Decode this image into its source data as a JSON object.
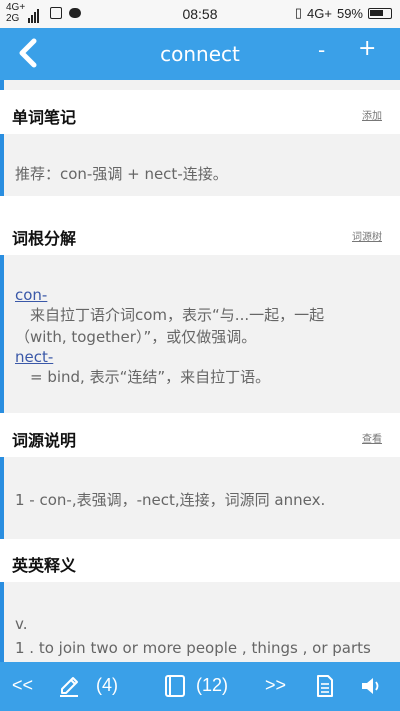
{
  "status_bar": {
    "net_top": "4G+",
    "net_bottom": "2G",
    "time": "08:58",
    "right_net": "4G+",
    "battery": "59%"
  },
  "header": {
    "title": "connect",
    "minus": "-",
    "plus": "+"
  },
  "sections": {
    "notes": {
      "title": "单词笔记",
      "link": "添加",
      "text": "推荐：con-强调 + nect-连接。"
    },
    "roots": {
      "title": "词根分解",
      "link": "词源树",
      "items": [
        {
          "root": "con-",
          "desc1": "来自拉丁语介词com，表示“与...一起，一起",
          "desc2": "（with, together）”，或仅做强调。"
        },
        {
          "root": "nect-",
          "desc1": "= bind, 表示“连结”，来自拉丁语。",
          "desc2": ""
        }
      ]
    },
    "etymology": {
      "title": "词源说明",
      "link": "查看",
      "text": "1 - con-,表强调，-nect,连接，词源同 annex."
    },
    "definitions": {
      "title": "英英释义",
      "pos": "v.",
      "text": "1 . to join two or more people , things , or parts"
    }
  },
  "bottom_bar": {
    "prev": "<<",
    "notes_count": "(4)",
    "book_count": "(12)",
    "next": ">>"
  },
  "colors": {
    "accent": "#3aa0e8",
    "card_bar": "#2a8ee0",
    "card_bg": "#f2f2f2"
  }
}
